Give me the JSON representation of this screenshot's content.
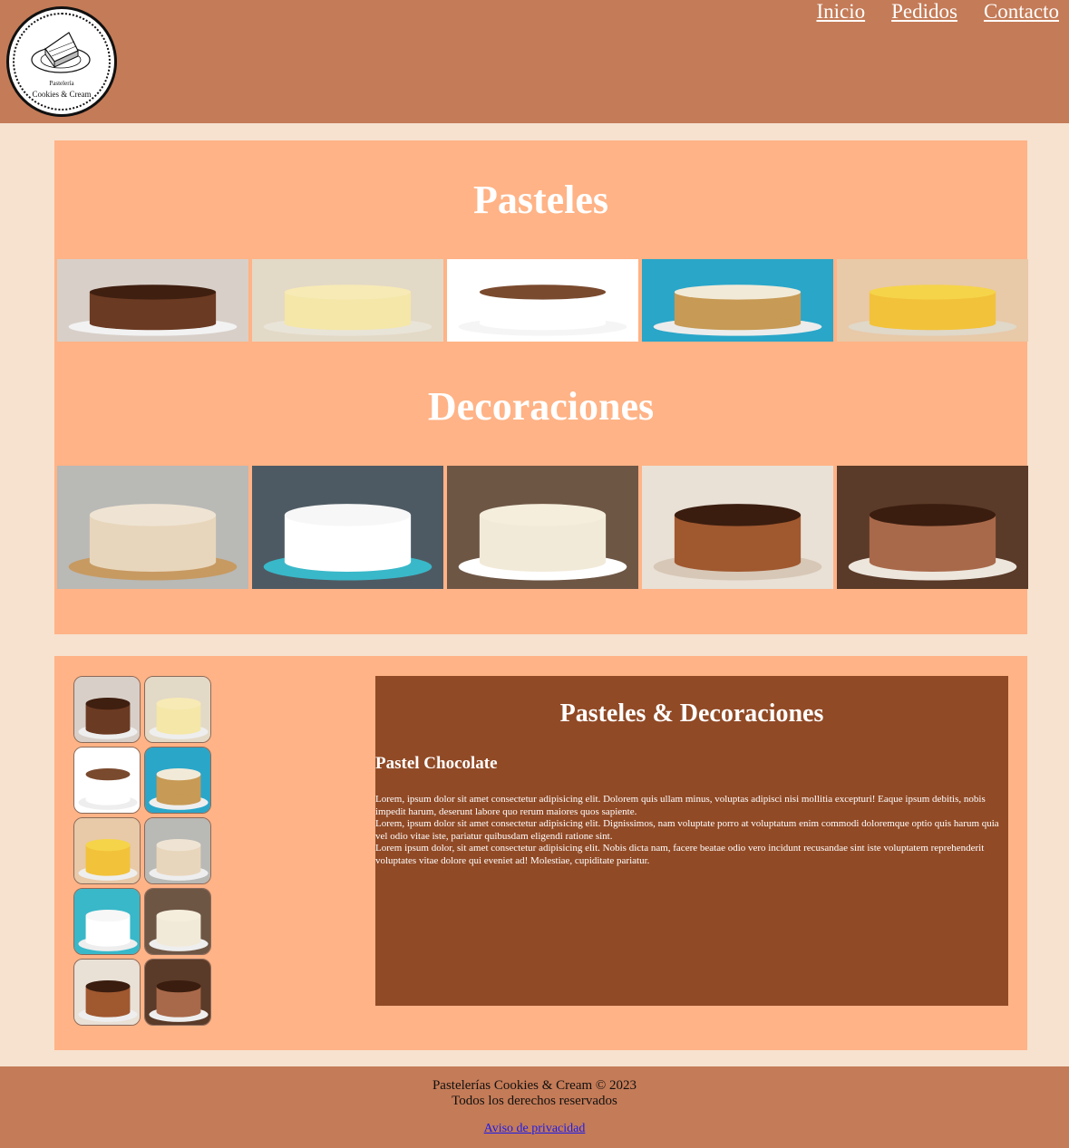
{
  "header": {
    "logo": {
      "line1": "Pastelería",
      "line2": "Cookies & Cream"
    },
    "nav": [
      "Inicio",
      "Pedidos",
      "Contacto"
    ]
  },
  "gallery": {
    "title1": "Pasteles",
    "title2": "Decoraciones",
    "pasteles": [
      {
        "name": "chocolate-cake-image",
        "bg": "#6b3a22",
        "top": "#3f1f10",
        "plate": "#f2f2f2",
        "backdrop": "#d8cfc8"
      },
      {
        "name": "vanilla-cream-cake-image",
        "bg": "#f4e7a8",
        "top": "#f7eab5",
        "plate": "#e9e4d8",
        "backdrop": "#e3d9c7"
      },
      {
        "name": "white-cake-image",
        "bg": "#ffffff",
        "top": "#7a4a2e",
        "plate": "#f5f5f5",
        "backdrop": "#ffffff"
      },
      {
        "name": "carrot-cake-image",
        "bg": "#c79a55",
        "top": "#f2ead8",
        "plate": "#ececec",
        "backdrop": "#2aa6c9"
      },
      {
        "name": "orange-cake-image",
        "bg": "#f2c23a",
        "top": "#f6d44a",
        "plate": "#e0d8c8",
        "backdrop": "#e8c9a8"
      }
    ],
    "decoraciones": [
      {
        "name": "naked-cake-image",
        "bg": "#e8d6bc",
        "top": "#efe4d3",
        "plate": "#c79a62",
        "backdrop": "#b9b9b6"
      },
      {
        "name": "confetti-cake-image",
        "bg": "#ffffff",
        "top": "#f7f7f7",
        "plate": "#39b8c9",
        "backdrop": "#4e5a63"
      },
      {
        "name": "rosette-cake-image",
        "bg": "#f2ead8",
        "top": "#f5eedd",
        "plate": "#ffffff",
        "backdrop": "#6e5645"
      },
      {
        "name": "chocolate-nut-cake-image",
        "bg": "#a0582f",
        "top": "#3a1d0f",
        "plate": "#d7c7b6",
        "backdrop": "#e9e0d6"
      },
      {
        "name": "chocolate-drip-cake-image",
        "bg": "#a8694a",
        "top": "#3a1d0f",
        "plate": "#ede6dd",
        "backdrop": "#5a3a28"
      }
    ]
  },
  "thumbs": [
    {
      "bg": "#6b3a22",
      "top": "#3f1f10",
      "backdrop": "#d8cfc8"
    },
    {
      "bg": "#f4e7a8",
      "top": "#f7eab5",
      "backdrop": "#e3d9c7"
    },
    {
      "bg": "#ffffff",
      "top": "#7a4a2e",
      "backdrop": "#ffffff"
    },
    {
      "bg": "#c79a55",
      "top": "#f2ead8",
      "backdrop": "#2aa6c9"
    },
    {
      "bg": "#f2c23a",
      "top": "#f6d44a",
      "backdrop": "#e8c9a8"
    },
    {
      "bg": "#e8d6bc",
      "top": "#efe4d3",
      "backdrop": "#b9b9b6"
    },
    {
      "bg": "#ffffff",
      "top": "#f7f7f7",
      "backdrop": "#39b8c9"
    },
    {
      "bg": "#f2ead8",
      "top": "#f5eedd",
      "backdrop": "#6e5645"
    },
    {
      "bg": "#a0582f",
      "top": "#3a1d0f",
      "backdrop": "#e9e0d6"
    },
    {
      "bg": "#a8694a",
      "top": "#3a1d0f",
      "backdrop": "#5a3a28"
    }
  ],
  "panel": {
    "title": "Pasteles & Decoraciones",
    "subtitle": "Pastel Chocolate",
    "paragraphs": [
      "Lorem, ipsum dolor sit amet consectetur adipisicing elit. Dolorem quis ullam minus, voluptas adipisci nisi mollitia excepturi! Eaque ipsum debitis, nobis impedit harum, deserunt labore quo rerum maiores quos sapiente.",
      "Lorem, ipsum dolor sit amet consectetur adipisicing elit. Dignissimos, nam voluptate porro at voluptatum enim commodi doloremque optio quis harum quia vel odio vitae iste, pariatur quibusdam eligendi ratione sint.",
      "Lorem ipsum dolor, sit amet consectetur adipisicing elit. Nobis dicta nam, facere beatae odio vero incidunt recusandae sint iste voluptatem reprehenderit voluptates vitae dolore qui eveniet ad! Molestiae, cupiditate pariatur."
    ]
  },
  "footer": {
    "line1": "Pastelerías Cookies & Cream © 2023",
    "line2": "Todos los derechos reservados",
    "privacy_link": "Aviso de privacidad"
  },
  "colors": {
    "header": "#c47b57",
    "page_bg": "#f7e1cf",
    "section_bg": "#ffb386",
    "panel_bg": "#914a26"
  }
}
